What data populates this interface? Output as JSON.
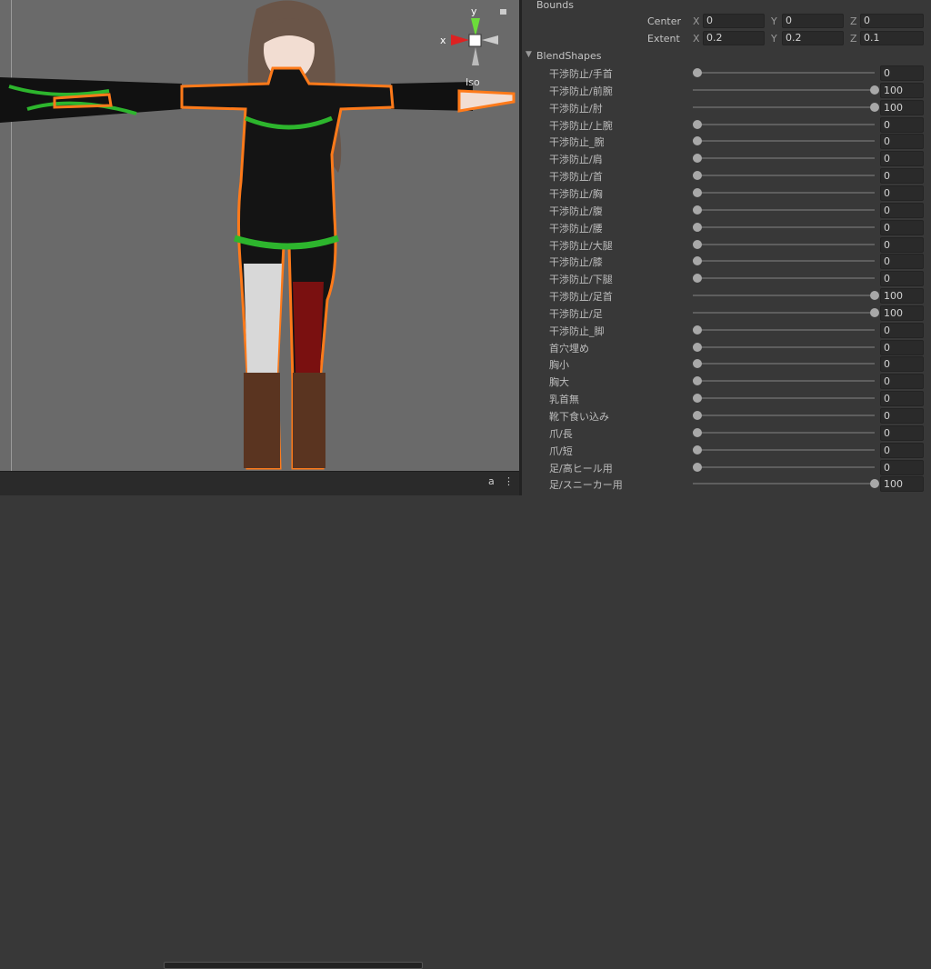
{
  "scene": {
    "view_mode": "Iso",
    "gizmo_x": "x",
    "gizmo_y": "y",
    "colors": {
      "outline": "#ff7a1a",
      "background": "#6a6a6a"
    }
  },
  "inspector": {
    "bounds": {
      "title": "Bounds",
      "center_label": "Center",
      "extent_label": "Extent",
      "center": {
        "x": "0",
        "y": "0",
        "z": "0"
      },
      "extent": {
        "x": "0.2",
        "y": "0.2",
        "z": "0.1"
      },
      "axis": {
        "x": "X",
        "y": "Y",
        "z": "Z"
      }
    },
    "blendshapes_title": "BlendShapes",
    "blendshapes": [
      {
        "name": "干渉防止/手首",
        "value": 0
      },
      {
        "name": "干渉防止/前腕",
        "value": 100
      },
      {
        "name": "干渉防止/肘",
        "value": 100
      },
      {
        "name": "干渉防止/上腕",
        "value": 0
      },
      {
        "name": "干渉防止_腕",
        "value": 0
      },
      {
        "name": "干渉防止/肩",
        "value": 0
      },
      {
        "name": "干渉防止/首",
        "value": 0
      },
      {
        "name": "干渉防止/胸",
        "value": 0
      },
      {
        "name": "干渉防止/腹",
        "value": 0
      },
      {
        "name": "干渉防止/腰",
        "value": 0
      },
      {
        "name": "干渉防止/大腿",
        "value": 0
      },
      {
        "name": "干渉防止/膝",
        "value": 0
      },
      {
        "name": "干渉防止/下腿",
        "value": 0
      },
      {
        "name": "干渉防止/足首",
        "value": 100
      },
      {
        "name": "干渉防止/足",
        "value": 100
      },
      {
        "name": "干渉防止_脚",
        "value": 0
      },
      {
        "name": "首穴埋め",
        "value": 0
      },
      {
        "name": "胸小",
        "value": 0
      },
      {
        "name": "胸大",
        "value": 0
      },
      {
        "name": "乳首無",
        "value": 0
      },
      {
        "name": "靴下食い込み",
        "value": 0
      },
      {
        "name": "爪/長",
        "value": 0
      },
      {
        "name": "爪/短",
        "value": 0
      },
      {
        "name": "足/高ヒール用",
        "value": 0
      },
      {
        "name": "足/スニーカー用",
        "value": 100
      }
    ]
  }
}
